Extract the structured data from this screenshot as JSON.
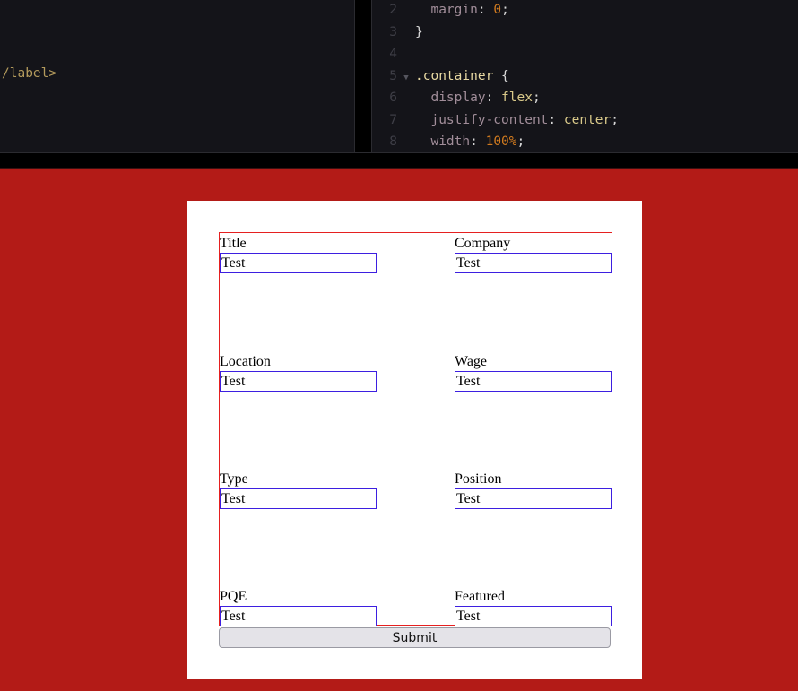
{
  "editor": {
    "left_pane": {
      "visible_text": "/label>"
    },
    "right_pane": {
      "lines": [
        {
          "num": "2",
          "parts": [
            {
              "t": "  ",
              "c": "punc"
            },
            {
              "t": "margin",
              "c": "prop"
            },
            {
              "t": ": ",
              "c": "punc"
            },
            {
              "t": "0",
              "c": "num"
            },
            {
              "t": ";",
              "c": "punc"
            }
          ]
        },
        {
          "num": "3",
          "parts": [
            {
              "t": "}",
              "c": "punc"
            }
          ]
        },
        {
          "num": "4",
          "parts": []
        },
        {
          "num": "5",
          "fold": "▼",
          "parts": [
            {
              "t": ".container",
              "c": "sel"
            },
            {
              "t": " {",
              "c": "punc"
            }
          ]
        },
        {
          "num": "6",
          "parts": [
            {
              "t": "  ",
              "c": "punc"
            },
            {
              "t": "display",
              "c": "prop"
            },
            {
              "t": ": ",
              "c": "punc"
            },
            {
              "t": "flex",
              "c": "kw"
            },
            {
              "t": ";",
              "c": "punc"
            }
          ]
        },
        {
          "num": "7",
          "parts": [
            {
              "t": "  ",
              "c": "punc"
            },
            {
              "t": "justify-content",
              "c": "prop"
            },
            {
              "t": ": ",
              "c": "punc"
            },
            {
              "t": "center",
              "c": "kw"
            },
            {
              "t": ";",
              "c": "punc"
            }
          ]
        },
        {
          "num": "8",
          "parts": [
            {
              "t": "  ",
              "c": "punc"
            },
            {
              "t": "width",
              "c": "prop"
            },
            {
              "t": ": ",
              "c": "punc"
            },
            {
              "t": "100%",
              "c": "num"
            },
            {
              "t": ";",
              "c": "punc"
            }
          ]
        }
      ]
    }
  },
  "form": {
    "fields": [
      {
        "label": "Title",
        "value": "Test"
      },
      {
        "label": "Company",
        "value": "Test"
      },
      {
        "label": "Location",
        "value": "Test"
      },
      {
        "label": "Wage",
        "value": "Test"
      },
      {
        "label": "Type",
        "value": "Test"
      },
      {
        "label": "Position",
        "value": "Test"
      },
      {
        "label": "PQE",
        "value": "Test"
      },
      {
        "label": "Featured",
        "value": "Test"
      }
    ],
    "submit_label": "Submit"
  },
  "colors": {
    "page_background": "#b31b17",
    "form_outline": "#e52020",
    "input_border": "#3d1fe0"
  }
}
